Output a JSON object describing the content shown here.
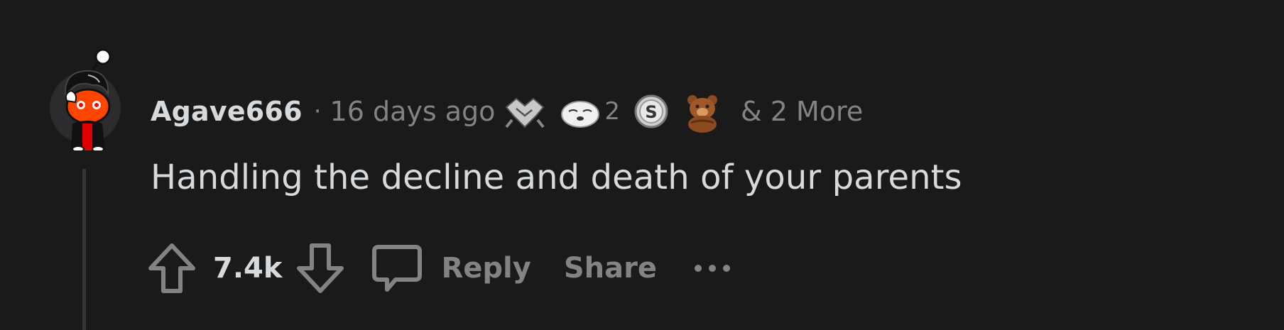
{
  "comment": {
    "author": "Agave666",
    "separator": "·",
    "timestamp": "16 days ago",
    "awards": [
      {
        "icon": "handshake-award-icon",
        "count": ""
      },
      {
        "icon": "seal-award-icon",
        "count": "2"
      },
      {
        "icon": "silver-award-icon",
        "count": ""
      },
      {
        "icon": "bear-award-icon",
        "count": ""
      }
    ],
    "more_awards": "& 2 More",
    "body": "Handling the decline and death of your parents",
    "score": "7.4k"
  },
  "actions": {
    "reply_label": "Reply",
    "share_label": "Share",
    "more_label": "•••"
  },
  "colors": {
    "background": "#1a1a1b",
    "text_primary": "#d7dadc",
    "text_muted": "#818384",
    "thread_line": "#343536",
    "avatar_red": "#ff4500"
  }
}
